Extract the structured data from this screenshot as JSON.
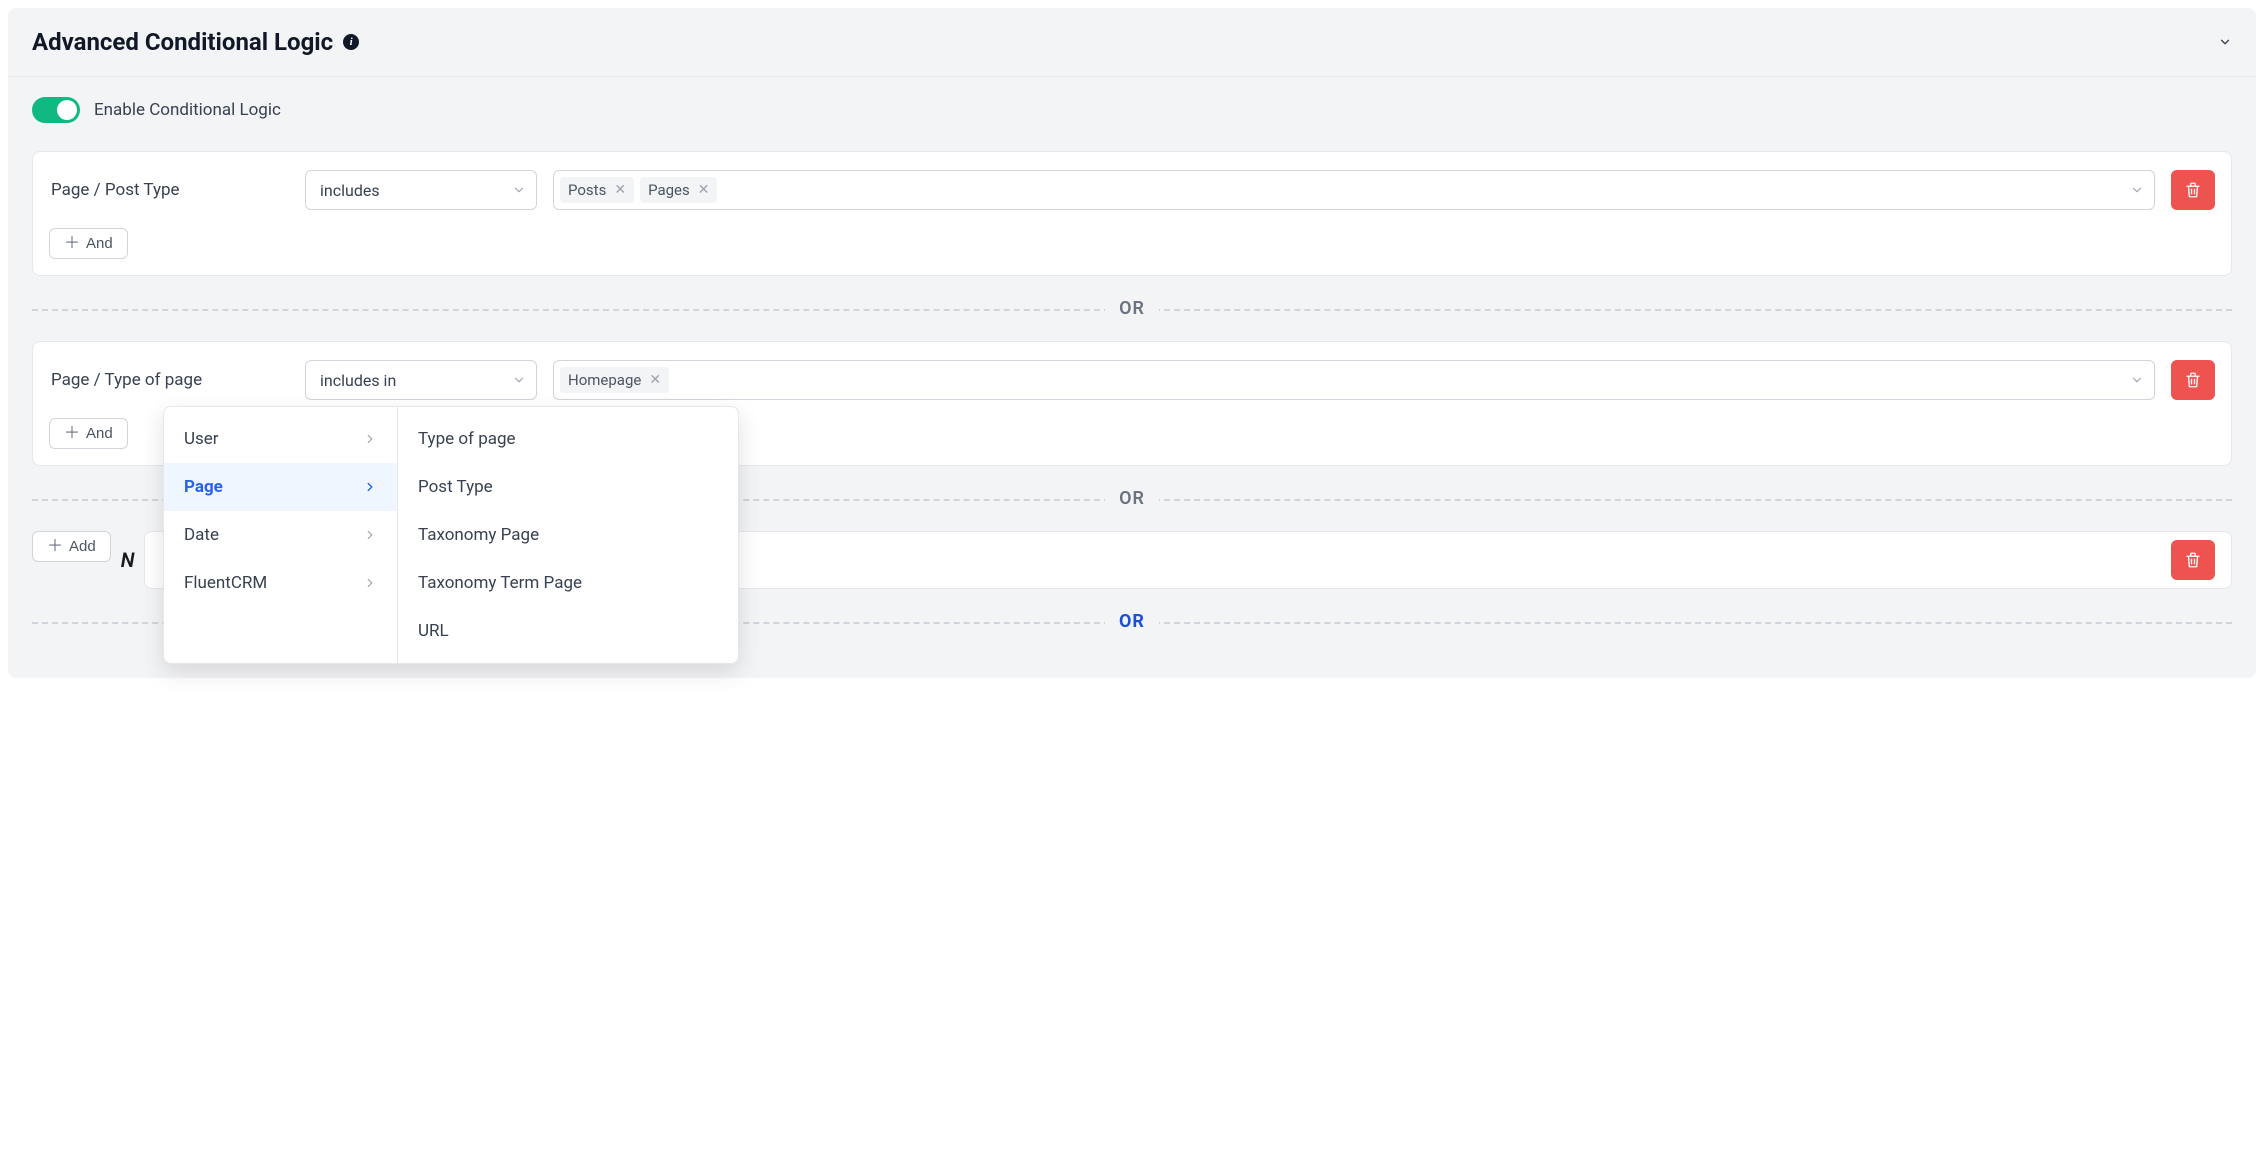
{
  "header": {
    "title": "Advanced Conditional Logic"
  },
  "toggle": {
    "label": "Enable Conditional Logic",
    "enabled": true
  },
  "groups": [
    {
      "label": "Page / Post Type",
      "operator": "includes",
      "values": [
        "Posts",
        "Pages"
      ],
      "and_label": "And"
    },
    {
      "label": "Page / Type of page",
      "operator": "includes in",
      "values": [
        "Homepage"
      ],
      "and_label": "And"
    }
  ],
  "or_label": "OR",
  "add_label": "Add",
  "cascade": {
    "column1": [
      {
        "label": "User",
        "active": false
      },
      {
        "label": "Page",
        "active": true
      },
      {
        "label": "Date",
        "active": false
      },
      {
        "label": "FluentCRM",
        "active": false
      }
    ],
    "column2": [
      "Type of page",
      "Post Type",
      "Taxonomy Page",
      "Taxonomy Term Page",
      "URL"
    ]
  }
}
